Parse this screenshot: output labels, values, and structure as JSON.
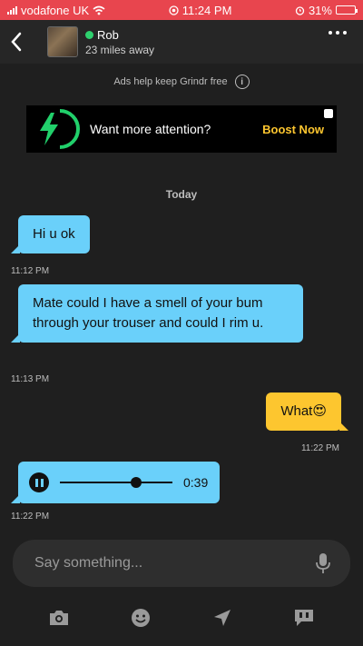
{
  "status_bar": {
    "carrier": "vodafone UK",
    "time": "11:24 PM",
    "battery": "31%",
    "battery_level": 0.31
  },
  "header": {
    "name": "Rob",
    "distance": "23 miles away",
    "online": true
  },
  "ad": {
    "note": "Ads help keep Grindr free",
    "banner_text": "Want more attention?",
    "cta": "Boost Now"
  },
  "chat": {
    "day_label": "Today",
    "messages": [
      {
        "direction": "in",
        "type": "text",
        "text": "Hi u ok",
        "time": "11:12 PM"
      },
      {
        "direction": "in",
        "type": "text",
        "text": "Mate could I have a smell of your bum through your trouser and could I rim u.",
        "time": "11:13 PM"
      },
      {
        "direction": "out",
        "type": "text",
        "text": "What😍",
        "time": "11:22 PM"
      },
      {
        "direction": "in",
        "type": "audio",
        "duration": "0:39",
        "progress": 0.68,
        "time": "11:22 PM"
      }
    ]
  },
  "composer": {
    "placeholder": "Say something..."
  },
  "toolbar": {
    "items": [
      "camera-icon",
      "emoji-icon",
      "location-icon",
      "saved-phrases-icon"
    ]
  },
  "colors": {
    "status_bar": "#e8454e",
    "incoming_bubble": "#6ad0fa",
    "outgoing_bubble": "#fdc62f",
    "online": "#2ed06e",
    "boost": "#fdc62f",
    "bolt": "#21d06b"
  }
}
